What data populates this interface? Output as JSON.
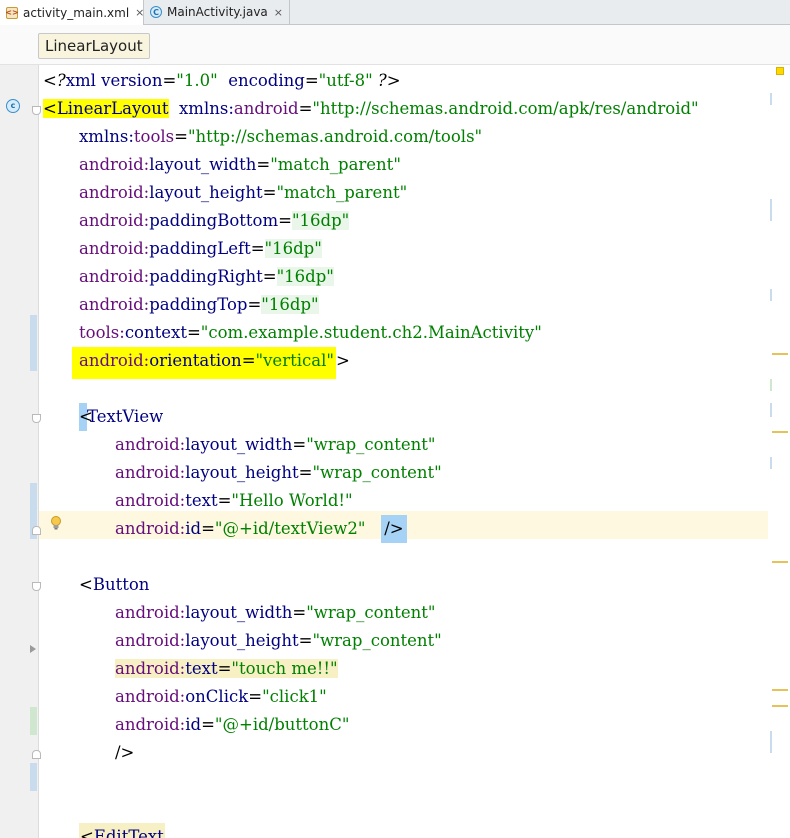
{
  "tabs": [
    {
      "label": "activity_main.xml",
      "icon": "xml-file-icon",
      "close": "×"
    },
    {
      "label": "MainActivity.java",
      "icon": "java-class-icon",
      "close": "×"
    }
  ],
  "breadcrumb": "LinearLayout",
  "gutter": {
    "class_marker": "c"
  },
  "code": {
    "l1": {
      "lt": "<",
      "q": "?",
      "xml": "xml",
      "version_attr": "version",
      "eq": "=",
      "version_val": "\"1.0\"",
      "encoding_attr": "encoding",
      "encoding_val": "\"utf-8\"",
      "end": " ?>"
    },
    "l2": {
      "lt": "<",
      "tag": "LinearLayout",
      "ns": "xmlns:",
      "ns_name": "android",
      "eq": "=",
      "val": "\"http://schemas.android.com/apk/res/android\""
    },
    "l3": {
      "ns": "xmlns:",
      "ns_name": "tools",
      "eq": "=",
      "val": "\"http://schemas.android.com/tools\""
    },
    "l4": {
      "prefix": "android:",
      "attr": "layout_width",
      "eq": "=",
      "val": "\"match_parent\""
    },
    "l5": {
      "prefix": "android:",
      "attr": "layout_height",
      "eq": "=",
      "val": "\"match_parent\""
    },
    "l6": {
      "prefix": "android:",
      "attr": "paddingBottom",
      "eq": "=",
      "val": "\"16dp\""
    },
    "l7": {
      "prefix": "android:",
      "attr": "paddingLeft",
      "eq": "=",
      "val": "\"16dp\""
    },
    "l8": {
      "prefix": "android:",
      "attr": "paddingRight",
      "eq": "=",
      "val": "\"16dp\""
    },
    "l9": {
      "prefix": "android:",
      "attr": "paddingTop",
      "eq": "=",
      "val": "\"16dp\""
    },
    "l10": {
      "prefix": "tools:",
      "attr": "context",
      "eq": "=",
      "val": "\"com.example.student.ch2.MainActivity\""
    },
    "l11": {
      "prefix": "android:",
      "attr": "orientation",
      "eq": "=",
      "val": "\"vertical\"",
      "end": ">"
    },
    "l13": {
      "lt": "<",
      "tag": "TextView"
    },
    "l14": {
      "prefix": "android:",
      "attr": "layout_width",
      "eq": "=",
      "val": "\"wrap_content\""
    },
    "l15": {
      "prefix": "android:",
      "attr": "layout_height",
      "eq": "=",
      "val": "\"wrap_content\""
    },
    "l16": {
      "prefix": "android:",
      "attr": "text",
      "eq": "=",
      "val": "\"Hello World!\""
    },
    "l17": {
      "prefix": "android:",
      "attr": "id",
      "eq": "=",
      "val": "\"@+id/textView2\"",
      "end": "/>"
    },
    "l19": {
      "lt": "<",
      "tag": "Button"
    },
    "l20": {
      "prefix": "android:",
      "attr": "layout_width",
      "eq": "=",
      "val": "\"wrap_content\""
    },
    "l21": {
      "prefix": "android:",
      "attr": "layout_height",
      "eq": "=",
      "val": "\"wrap_content\""
    },
    "l22": {
      "prefix": "android:",
      "attr": "text",
      "eq": "=",
      "val": "\"touch me!!\""
    },
    "l23": {
      "prefix": "android:",
      "attr": "onClick",
      "eq": "=",
      "val": "\"click1\""
    },
    "l24": {
      "prefix": "android:",
      "attr": "id",
      "eq": "=",
      "val": "\"@+id/buttonC\""
    },
    "l25": {
      "end": "/>"
    },
    "l27": {
      "lt": "<",
      "tag": "EditText"
    }
  },
  "colors": {
    "tag": "#000080",
    "attr": "#660e7a",
    "value": "#008000",
    "highlight": "#ffff00",
    "current_line": "#fdf8df"
  }
}
